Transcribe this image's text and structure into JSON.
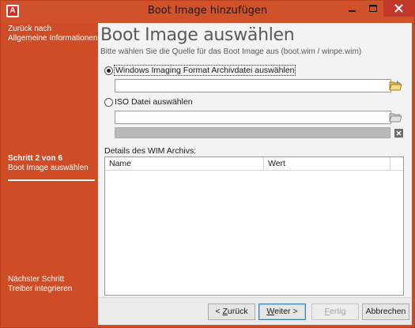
{
  "window": {
    "title": "Boot Image hinzufügen",
    "app_icon_letter": "A",
    "icons": {
      "minimize": "minimize-icon",
      "maximize": "maximize-icon",
      "close": "close-icon"
    },
    "colors": {
      "accent": "#cf4d26",
      "close": "#c4382b"
    }
  },
  "sidebar": {
    "back_line1": "Zurück nach",
    "back_line2": "Allgemeine Informationen",
    "step_line1": "Schritt 2 von 6",
    "step_line2": "Boot Image auswählen",
    "next_line1": "Nächster Schritt",
    "next_line2": "Treiber integrieren"
  },
  "main": {
    "title": "Boot Image auswählen",
    "subtitle": "Bitte wählen Sie die Quelle für das Boot Image aus (boot.wim / winpe.wim)",
    "option_wim": {
      "label": "Windows Imaging Format Archivdatei auswählen",
      "selected": true,
      "value": ""
    },
    "option_iso": {
      "label": "ISO Datei auswählen",
      "selected": false,
      "value": ""
    },
    "details_label": "Details des WIM Archivs:",
    "grid_columns": [
      "Name",
      "Wert"
    ]
  },
  "footer": {
    "back_prefix": "< ",
    "back_key": "Z",
    "back_rest": "urück",
    "next_key": "W",
    "next_rest": "eiter >",
    "finish_key": "F",
    "finish_rest": "ertig",
    "cancel": "Abbrechen"
  }
}
